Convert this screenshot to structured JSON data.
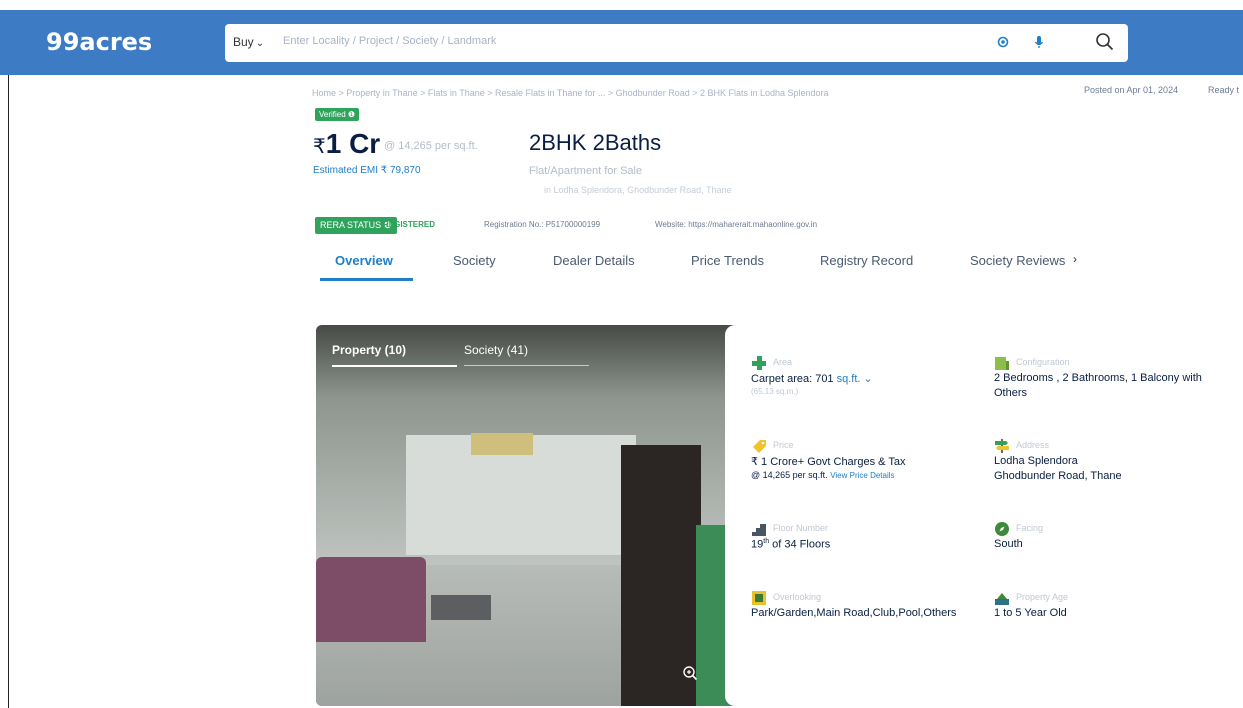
{
  "header": {
    "logo": "99acres",
    "buy_label": "Buy",
    "search_placeholder": "Enter Locality / Project / Society / Landmark"
  },
  "breadcrumb": "Home > Property in Thane > Flats in Thane > Resale Flats in Thane for ... > Ghodbunder Road > 2 BHK Flats in Lodha Splendora",
  "posted": "Posted on Apr 01, 2024",
  "ready": "Ready t",
  "verified": "Verified",
  "price": {
    "symbol": "₹",
    "value": "1 Cr",
    "per_sqft": "@ 14,265 per sq.ft.",
    "emi": "Estimated EMI ₹ 79,870"
  },
  "title": {
    "bhk": "2BHK 2Baths",
    "type": "Flat/Apartment for Sale",
    "address": "in Lodha Splendora, Ghodbunder Road, Thane"
  },
  "rera": {
    "status": "RERA STATUS",
    "registered": "REGISTERED",
    "registration": "Registration No.: P51700000199",
    "website": "Website: https://maharerait.mahaonline.gov.in"
  },
  "tabs": [
    "Overview",
    "Society",
    "Dealer Details",
    "Price Trends",
    "Registry Record",
    "Society Reviews"
  ],
  "gallery": {
    "tab1": "Property (10)",
    "tab2": "Society (41)"
  },
  "details": {
    "area": {
      "label": "Area",
      "value": "Carpet area: 701",
      "unit": "sq.ft.",
      "sub": "(65.13 sq.m.)"
    },
    "configuration": {
      "label": "Configuration",
      "line1": "2 Bedrooms , 2 Bathrooms, 1 Balcony with",
      "line2": "Others"
    },
    "price": {
      "label": "Price",
      "line1": "₹ 1 Crore+ Govt Charges & Tax",
      "line2": "@ 14,265 per sq.ft.",
      "link": "View Price Details"
    },
    "address": {
      "label": "Address",
      "line1": "Lodha Splendora",
      "line2": "Ghodbunder Road, Thane"
    },
    "floor": {
      "label": "Floor Number",
      "floor": "19",
      "sup": "th",
      "rest": "of 34 Floors"
    },
    "facing": {
      "label": "Facing",
      "value": "South"
    },
    "overlooking": {
      "label": "Overlooking",
      "value": "Park/Garden,Main Road,Club,Pool,Others"
    },
    "age": {
      "label": "Property Age",
      "value": "1 to 5 Year Old"
    }
  },
  "colors": {
    "header": "#3d7cc4",
    "accent": "#1f7ec7",
    "green": "#2fa35c"
  }
}
